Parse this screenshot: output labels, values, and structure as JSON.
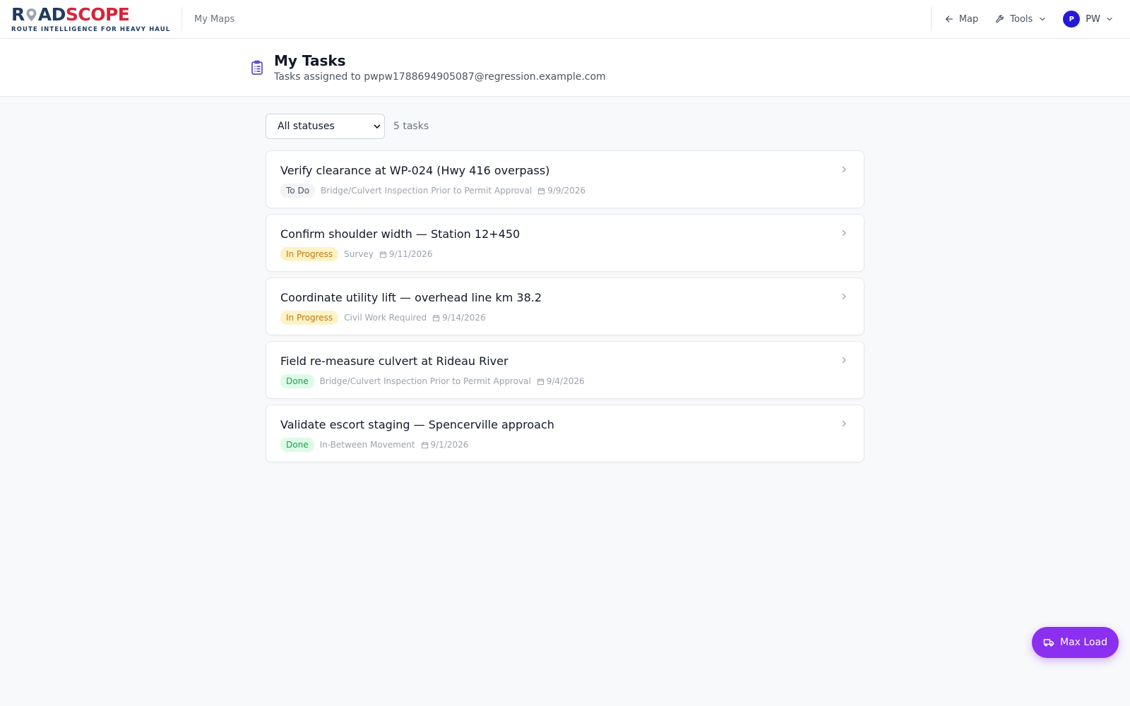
{
  "brand": {
    "name_part1": "R",
    "name_part2": "AD",
    "name_part3": "SCOPE",
    "tagline": "ROUTE INTELLIGENCE FOR HEAVY HAUL",
    "color_navy": "#1e3a5f",
    "color_red": "#d6243a"
  },
  "nav": {
    "my_maps": "My Maps",
    "map": "Map",
    "tools": "Tools",
    "user_avatar": "P",
    "user_initials": "PW"
  },
  "header": {
    "title": "My Tasks",
    "subtitle": "Tasks assigned to pwpw1788694905087@regression.example.com"
  },
  "filters": {
    "status_selected": "All statuses",
    "count": "5 tasks"
  },
  "tasks": [
    {
      "title": "Verify clearance at WP-024 (Hwy 416 overpass)",
      "status": "To Do",
      "status_kind": "todo",
      "type": "Bridge/Culvert Inspection Prior to Permit Approval",
      "date": "9/9/2026"
    },
    {
      "title": "Confirm shoulder width — Station 12+450",
      "status": "In Progress",
      "status_kind": "progress",
      "type": "Survey",
      "date": "9/11/2026"
    },
    {
      "title": "Coordinate utility lift — overhead line km 38.2",
      "status": "In Progress",
      "status_kind": "progress",
      "type": "Civil Work Required",
      "date": "9/14/2026"
    },
    {
      "title": "Field re-measure culvert at Rideau River",
      "status": "Done",
      "status_kind": "done",
      "type": "Bridge/Culvert Inspection Prior to Permit Approval",
      "date": "9/4/2026"
    },
    {
      "title": "Validate escort staging — Spencerville approach",
      "status": "Done",
      "status_kind": "done",
      "type": "In-Between Movement",
      "date": "9/1/2026"
    }
  ],
  "fab": {
    "label": "Max Load",
    "color": "#8b2ff0"
  },
  "icons": {
    "back": "arrow-left-icon",
    "tools": "wrench-icon",
    "page": "clipboard-list-icon",
    "date": "calendar-icon",
    "row": "chevron-right-icon",
    "fab": "truck-icon"
  }
}
